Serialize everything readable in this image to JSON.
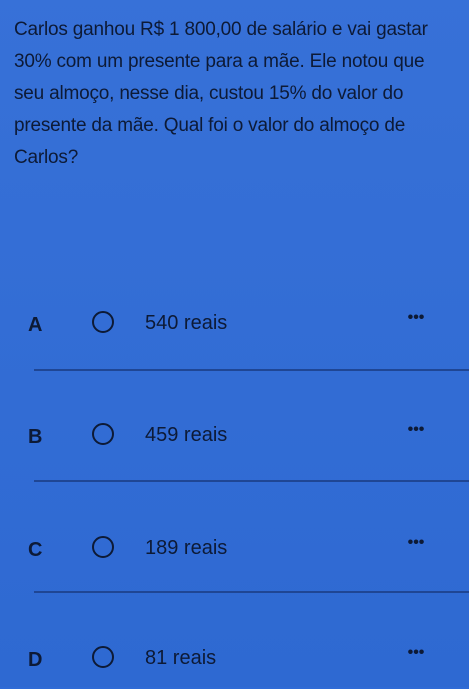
{
  "question": {
    "text": "Carlos ganhou R$ 1 800,00 de salário e vai gastar 30% com um presente para a mãe. Ele notou que seu almoço, nesse dia, custou 15% do valor do presente da mãe. Qual foi o valor do almoço de Carlos?"
  },
  "options": [
    {
      "letter": "A",
      "text": "540 reais",
      "more": "•••"
    },
    {
      "letter": "B",
      "text": "459 reais",
      "more": "•••"
    },
    {
      "letter": "C",
      "text": "189 reais",
      "more": "•••"
    },
    {
      "letter": "D",
      "text": "81 reais",
      "more": "•••"
    }
  ],
  "colors": {
    "background": "#2f6bd6",
    "text": "#0d1a36",
    "divider": "#1c3f88"
  },
  "icons": {
    "radio": "radio-empty-icon",
    "more": "more-options-icon"
  }
}
